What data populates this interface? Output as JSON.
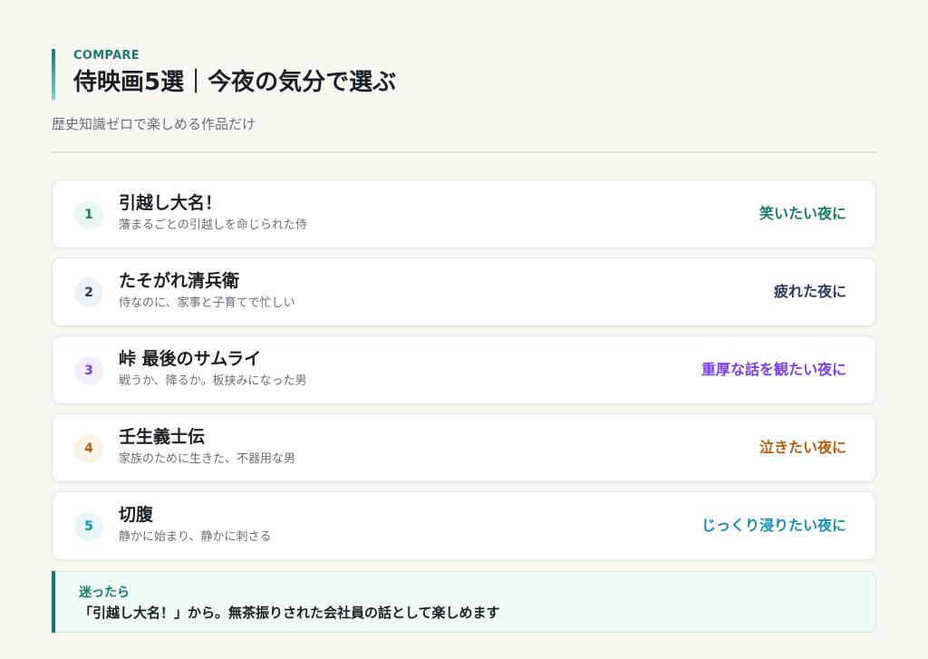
{
  "header": {
    "eyebrow": "COMPARE",
    "title": "侍映画5選｜今夜の気分で選ぶ",
    "subtitle": "歴史知識ゼロで楽しめる作品だけ"
  },
  "films": [
    {
      "rank": "1",
      "title": "引越し大名！",
      "description": "藩まるごとの引越しを命じられた侍",
      "mood": "笑いたい夜に",
      "color": "#1d7a6c",
      "badge_bg": "#e9f7f3"
    },
    {
      "rank": "2",
      "title": "たそがれ清兵衛",
      "description": "侍なのに、家事と子育てで忙しい",
      "mood": "疲れた夜に",
      "color": "#2b3a5e",
      "badge_bg": "#eef1f7"
    },
    {
      "rank": "3",
      "title": "峠 最後のサムライ",
      "description": "戦うか、降るか。板挟みになった男",
      "mood": "重厚な話を観たい夜に",
      "color": "#7b3fe4",
      "badge_bg": "#f3eefd"
    },
    {
      "rank": "4",
      "title": "壬生義士伝",
      "description": "家族のために生きた、不器用な男",
      "mood": "泣きたい夜に",
      "color": "#b85c12",
      "badge_bg": "#fcf3e7"
    },
    {
      "rank": "5",
      "title": "切腹",
      "description": "静かに始まり、静かに刺さる",
      "mood": "じっくり浸りたい夜に",
      "color": "#1b8fae",
      "badge_bg": "#e8f6fa"
    }
  ],
  "footer": {
    "label": "迷ったら",
    "text": "「引越し大名！」から。無茶振りされた会社員の話として楽しめます"
  }
}
